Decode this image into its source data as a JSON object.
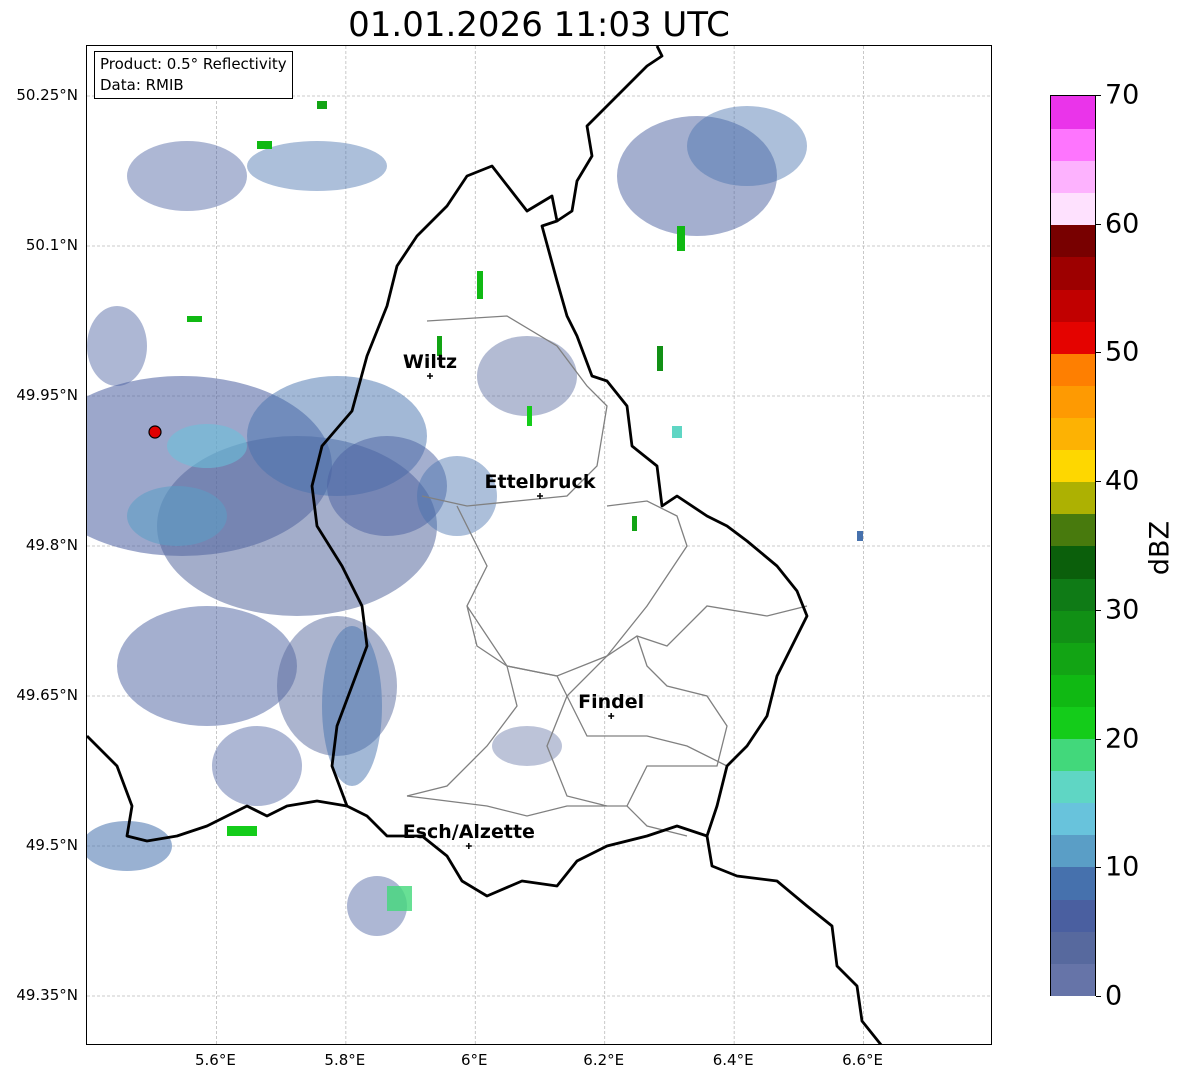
{
  "title": "01.01.2026 11:03 UTC",
  "info_box": {
    "product": "Product: 0.5° Reflectivity",
    "data": "Data: RMIB"
  },
  "map": {
    "lon_range": [
      5.4,
      6.8
    ],
    "lat_range": [
      49.3,
      50.3
    ],
    "lat_ticks": [
      "50.25°N",
      "50.1°N",
      "49.95°N",
      "49.8°N",
      "49.65°N",
      "49.5°N",
      "49.35°N"
    ],
    "lon_ticks": [
      "5.6°E",
      "5.8°E",
      "6°E",
      "6.2°E",
      "6.4°E",
      "6.6°E"
    ],
    "gridlines": true,
    "radar_site_color": "#e00000",
    "cities": [
      {
        "name": "Wiltz",
        "lon": 5.93,
        "lat": 49.97
      },
      {
        "name": "Ettelbruck",
        "lon": 6.1,
        "lat": 49.85
      },
      {
        "name": "Findel",
        "lon": 6.21,
        "lat": 49.63
      },
      {
        "name": "Esch/Alzette",
        "lon": 5.99,
        "lat": 49.5
      }
    ]
  },
  "colorbar": {
    "label": "dBZ",
    "ticks": [
      "0",
      "10",
      "20",
      "30",
      "40",
      "50",
      "60",
      "70"
    ],
    "colors": [
      "#6674a8",
      "#57699e",
      "#4a5fa0",
      "#4671ad",
      "#5a9ec6",
      "#68c3dc",
      "#5fd6c4",
      "#42d87b",
      "#14cc1a",
      "#10b913",
      "#12a414",
      "#119015",
      "#0f7b16",
      "#0b5f0b",
      "#487a0d",
      "#adb102",
      "#fed700",
      "#fdb203",
      "#fe9a02",
      "#fe7f01",
      "#e40300",
      "#c10000",
      "#9d0000",
      "#780000",
      "#fee1fe",
      "#fdb2fe",
      "#fe75fe",
      "#ea34ea"
    ]
  }
}
